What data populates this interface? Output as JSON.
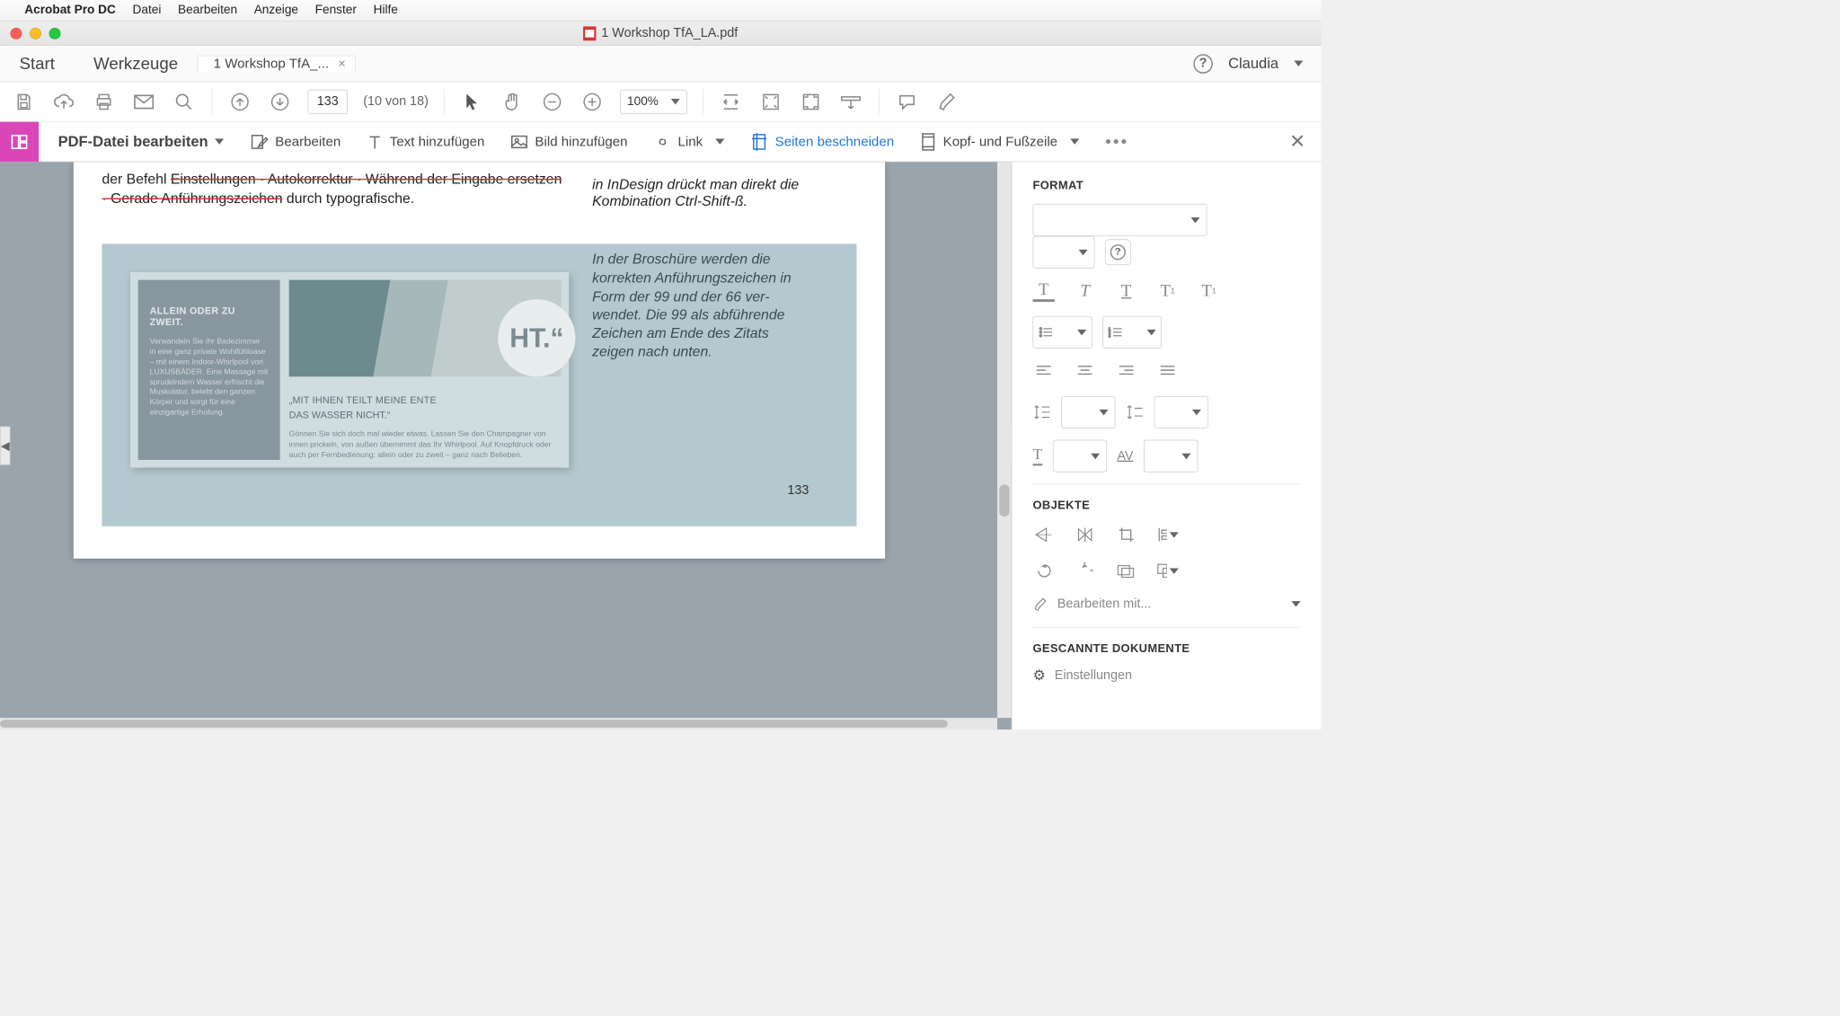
{
  "menu": {
    "app": "Acrobat Pro DC",
    "items": [
      "Datei",
      "Bearbeiten",
      "Anzeige",
      "Fenster",
      "Hilfe"
    ]
  },
  "window": {
    "title": "1 Workshop TfA_LA.pdf"
  },
  "tabs": {
    "start": "Start",
    "tools": "Werkzeuge",
    "doc": "1 Workshop TfA_..."
  },
  "user": {
    "name": "Claudia"
  },
  "toolbar": {
    "page_value": "133",
    "page_count_label": "(10 von 18)",
    "zoom": "100%"
  },
  "edit_toolbar": {
    "title": "PDF-Datei bearbeiten",
    "edit": "Bearbeiten",
    "add_text": "Text hinzufügen",
    "add_image": "Bild hinzufügen",
    "link": "Link",
    "crop": "Seiten beschneiden",
    "header_footer": "Kopf- und Fußzeile"
  },
  "doc": {
    "line1_a": "der Befehl ",
    "line1_s1": "Einstellungen · Autokorrektur · Während der Eingabe ersetzen",
    "line2_s": "· Gerade Anführungszeichen",
    "line2_b": " durch typografische.",
    "right1": "in InDesign drückt man direkt die Kombination Ctrl-Shift-ß.",
    "broch_side": "In der Broschüre werden die korrekten Anführungszeichen in Form der 99 und der 66 ver­wendet. Die 99 als abführen­de Zeichen am Ende des Zitats zeigen nach unten.",
    "bro_left_h": "ALLEIN ODER ZU ZWEIT.",
    "bro_left_p": "Verwandeln Sie Ihr Badezimmer in eine ganz private Wohlfühloase – mit einem Indoor-Whirlpool von LUXUSBÄDER. Eine Massage mit sprudelndem Wasser erfrischt die Muskulatur, belebt den ganzen Körper und sorgt für eine einzigartige Erholung.",
    "circle": "HT.“",
    "bro_cap1": "„MIT IHNEN TEILT MEINE ENTE",
    "bro_cap2": "DAS WASSER NICHT.“",
    "bro_body": "Gönnen Sie sich doch mal wieder etwas. Lassen Sie den Champagner von innen prickeln, von außen übernimmt das Ihr Whirlpool. Auf Knopfdruck oder auch per Fernbedienung: allein oder zu zweit – ganz nach Belieben.",
    "page_number": "133"
  },
  "side": {
    "format": "FORMAT",
    "objects": "OBJEKTE",
    "edit_with": "Bearbeiten mit...",
    "scanned": "GESCANNTE DOKUMENTE",
    "settings": "Einstellungen"
  }
}
